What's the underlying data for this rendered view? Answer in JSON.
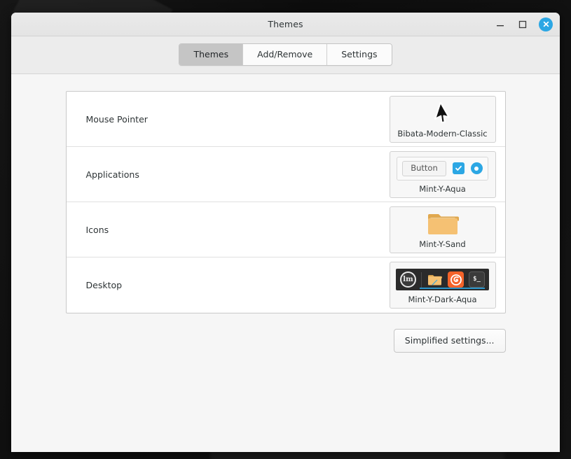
{
  "window": {
    "title": "Themes",
    "controls": {
      "minimize": "minimize",
      "maximize": "maximize",
      "close": "×"
    }
  },
  "tabs": [
    {
      "label": "Themes",
      "active": true
    },
    {
      "label": "Add/Remove",
      "active": false
    },
    {
      "label": "Settings",
      "active": false
    }
  ],
  "rows": [
    {
      "label": "Mouse Pointer",
      "value": "Bibata-Modern-Classic",
      "preview": "cursor"
    },
    {
      "label": "Applications",
      "value": "Mint-Y-Aqua",
      "preview": "widgets",
      "widgets": {
        "button_label": "Button",
        "checkbox_checked": true,
        "radio_selected": true
      }
    },
    {
      "label": "Icons",
      "value": "Mint-Y-Sand",
      "preview": "folder"
    },
    {
      "label": "Desktop",
      "value": "Mint-Y-Dark-Aqua",
      "preview": "panel",
      "panel_items": [
        "mint-menu",
        "folder",
        "firefox",
        "terminal"
      ],
      "terminal_glyph": "$_"
    }
  ],
  "footer": {
    "simplified_settings_label": "Simplified settings..."
  },
  "colors": {
    "accent": "#2ca7e4",
    "folder": "#f5c173",
    "folder_dark": "#e0a84f",
    "firefox": "#f4632a",
    "panel_bg": "#2b2b2b",
    "titlebar": "#e8e8e8",
    "content_bg": "#f6f6f6",
    "tab_active": "#c5c5c5"
  }
}
